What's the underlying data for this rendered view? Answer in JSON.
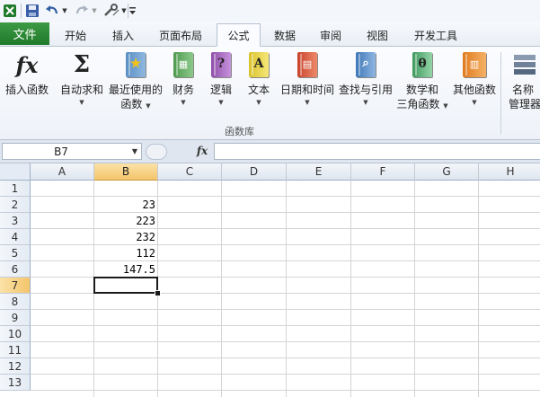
{
  "colors": {
    "file_tab": "#2a8a34",
    "selection_header": "#f4c56b",
    "grid_line": "#d4d4d4"
  },
  "quick_access": [
    "excel-icon",
    "save-icon",
    "undo-icon",
    "redo-icon",
    "tools-icon",
    "customize-icon"
  ],
  "tabs": {
    "file": "文件",
    "items": [
      "开始",
      "插入",
      "页面布局",
      "公式",
      "数据",
      "审阅",
      "视图",
      "开发工具"
    ],
    "active": "公式"
  },
  "ribbon": {
    "insert_function": {
      "icon_text": "fx",
      "label": "插入函数"
    },
    "autosum": {
      "icon_text": "Σ",
      "label": "自动求和"
    },
    "recent": {
      "label": "最近使用的",
      "label2": "函数"
    },
    "financial": {
      "label": "财务"
    },
    "logical": {
      "icon_text": "?",
      "label": "逻辑"
    },
    "text": {
      "icon_text": "A",
      "label": "文本"
    },
    "datetime": {
      "label": "日期和时间"
    },
    "lookup": {
      "label": "查找与引用"
    },
    "math": {
      "icon_text": "θ",
      "label": "数学和",
      "label2": "三角函数"
    },
    "more": {
      "label": "其他函数"
    },
    "name_manager": {
      "label": "名称",
      "label2": "管理器"
    },
    "group_label": "函数库"
  },
  "formula_bar": {
    "name_box": "B7",
    "fx": "fx",
    "formula": ""
  },
  "sheet": {
    "columns": [
      "A",
      "B",
      "C",
      "D",
      "E",
      "F",
      "G",
      "H"
    ],
    "rows": [
      "1",
      "2",
      "3",
      "4",
      "5",
      "6",
      "7",
      "8",
      "9",
      "10",
      "11",
      "12",
      "13"
    ],
    "selected_column": "B",
    "selected_row": "7",
    "cells": [
      {
        "ref": "B2",
        "value": "23"
      },
      {
        "ref": "B3",
        "value": "223"
      },
      {
        "ref": "B4",
        "value": "232"
      },
      {
        "ref": "B5",
        "value": "112"
      },
      {
        "ref": "B6",
        "value": "147.5"
      }
    ]
  }
}
